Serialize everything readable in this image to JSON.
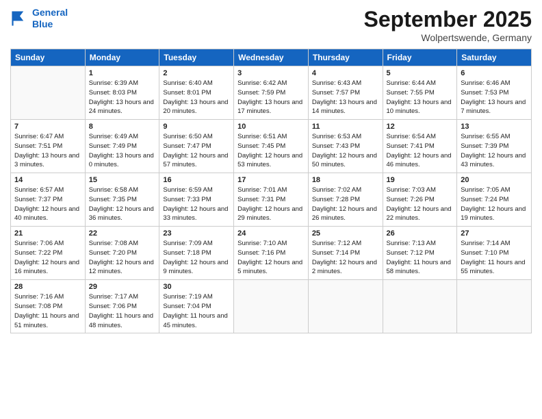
{
  "logo": {
    "line1": "General",
    "line2": "Blue"
  },
  "title": "September 2025",
  "location": "Wolpertswende, Germany",
  "weekdays": [
    "Sunday",
    "Monday",
    "Tuesday",
    "Wednesday",
    "Thursday",
    "Friday",
    "Saturday"
  ],
  "weeks": [
    [
      {
        "day": "",
        "sunrise": "",
        "sunset": "",
        "daylight": ""
      },
      {
        "day": "1",
        "sunrise": "Sunrise: 6:39 AM",
        "sunset": "Sunset: 8:03 PM",
        "daylight": "Daylight: 13 hours and 24 minutes."
      },
      {
        "day": "2",
        "sunrise": "Sunrise: 6:40 AM",
        "sunset": "Sunset: 8:01 PM",
        "daylight": "Daylight: 13 hours and 20 minutes."
      },
      {
        "day": "3",
        "sunrise": "Sunrise: 6:42 AM",
        "sunset": "Sunset: 7:59 PM",
        "daylight": "Daylight: 13 hours and 17 minutes."
      },
      {
        "day": "4",
        "sunrise": "Sunrise: 6:43 AM",
        "sunset": "Sunset: 7:57 PM",
        "daylight": "Daylight: 13 hours and 14 minutes."
      },
      {
        "day": "5",
        "sunrise": "Sunrise: 6:44 AM",
        "sunset": "Sunset: 7:55 PM",
        "daylight": "Daylight: 13 hours and 10 minutes."
      },
      {
        "day": "6",
        "sunrise": "Sunrise: 6:46 AM",
        "sunset": "Sunset: 7:53 PM",
        "daylight": "Daylight: 13 hours and 7 minutes."
      }
    ],
    [
      {
        "day": "7",
        "sunrise": "Sunrise: 6:47 AM",
        "sunset": "Sunset: 7:51 PM",
        "daylight": "Daylight: 13 hours and 3 minutes."
      },
      {
        "day": "8",
        "sunrise": "Sunrise: 6:49 AM",
        "sunset": "Sunset: 7:49 PM",
        "daylight": "Daylight: 13 hours and 0 minutes."
      },
      {
        "day": "9",
        "sunrise": "Sunrise: 6:50 AM",
        "sunset": "Sunset: 7:47 PM",
        "daylight": "Daylight: 12 hours and 57 minutes."
      },
      {
        "day": "10",
        "sunrise": "Sunrise: 6:51 AM",
        "sunset": "Sunset: 7:45 PM",
        "daylight": "Daylight: 12 hours and 53 minutes."
      },
      {
        "day": "11",
        "sunrise": "Sunrise: 6:53 AM",
        "sunset": "Sunset: 7:43 PM",
        "daylight": "Daylight: 12 hours and 50 minutes."
      },
      {
        "day": "12",
        "sunrise": "Sunrise: 6:54 AM",
        "sunset": "Sunset: 7:41 PM",
        "daylight": "Daylight: 12 hours and 46 minutes."
      },
      {
        "day": "13",
        "sunrise": "Sunrise: 6:55 AM",
        "sunset": "Sunset: 7:39 PM",
        "daylight": "Daylight: 12 hours and 43 minutes."
      }
    ],
    [
      {
        "day": "14",
        "sunrise": "Sunrise: 6:57 AM",
        "sunset": "Sunset: 7:37 PM",
        "daylight": "Daylight: 12 hours and 40 minutes."
      },
      {
        "day": "15",
        "sunrise": "Sunrise: 6:58 AM",
        "sunset": "Sunset: 7:35 PM",
        "daylight": "Daylight: 12 hours and 36 minutes."
      },
      {
        "day": "16",
        "sunrise": "Sunrise: 6:59 AM",
        "sunset": "Sunset: 7:33 PM",
        "daylight": "Daylight: 12 hours and 33 minutes."
      },
      {
        "day": "17",
        "sunrise": "Sunrise: 7:01 AM",
        "sunset": "Sunset: 7:31 PM",
        "daylight": "Daylight: 12 hours and 29 minutes."
      },
      {
        "day": "18",
        "sunrise": "Sunrise: 7:02 AM",
        "sunset": "Sunset: 7:28 PM",
        "daylight": "Daylight: 12 hours and 26 minutes."
      },
      {
        "day": "19",
        "sunrise": "Sunrise: 7:03 AM",
        "sunset": "Sunset: 7:26 PM",
        "daylight": "Daylight: 12 hours and 22 minutes."
      },
      {
        "day": "20",
        "sunrise": "Sunrise: 7:05 AM",
        "sunset": "Sunset: 7:24 PM",
        "daylight": "Daylight: 12 hours and 19 minutes."
      }
    ],
    [
      {
        "day": "21",
        "sunrise": "Sunrise: 7:06 AM",
        "sunset": "Sunset: 7:22 PM",
        "daylight": "Daylight: 12 hours and 16 minutes."
      },
      {
        "day": "22",
        "sunrise": "Sunrise: 7:08 AM",
        "sunset": "Sunset: 7:20 PM",
        "daylight": "Daylight: 12 hours and 12 minutes."
      },
      {
        "day": "23",
        "sunrise": "Sunrise: 7:09 AM",
        "sunset": "Sunset: 7:18 PM",
        "daylight": "Daylight: 12 hours and 9 minutes."
      },
      {
        "day": "24",
        "sunrise": "Sunrise: 7:10 AM",
        "sunset": "Sunset: 7:16 PM",
        "daylight": "Daylight: 12 hours and 5 minutes."
      },
      {
        "day": "25",
        "sunrise": "Sunrise: 7:12 AM",
        "sunset": "Sunset: 7:14 PM",
        "daylight": "Daylight: 12 hours and 2 minutes."
      },
      {
        "day": "26",
        "sunrise": "Sunrise: 7:13 AM",
        "sunset": "Sunset: 7:12 PM",
        "daylight": "Daylight: 11 hours and 58 minutes."
      },
      {
        "day": "27",
        "sunrise": "Sunrise: 7:14 AM",
        "sunset": "Sunset: 7:10 PM",
        "daylight": "Daylight: 11 hours and 55 minutes."
      }
    ],
    [
      {
        "day": "28",
        "sunrise": "Sunrise: 7:16 AM",
        "sunset": "Sunset: 7:08 PM",
        "daylight": "Daylight: 11 hours and 51 minutes."
      },
      {
        "day": "29",
        "sunrise": "Sunrise: 7:17 AM",
        "sunset": "Sunset: 7:06 PM",
        "daylight": "Daylight: 11 hours and 48 minutes."
      },
      {
        "day": "30",
        "sunrise": "Sunrise: 7:19 AM",
        "sunset": "Sunset: 7:04 PM",
        "daylight": "Daylight: 11 hours and 45 minutes."
      },
      {
        "day": "",
        "sunrise": "",
        "sunset": "",
        "daylight": ""
      },
      {
        "day": "",
        "sunrise": "",
        "sunset": "",
        "daylight": ""
      },
      {
        "day": "",
        "sunrise": "",
        "sunset": "",
        "daylight": ""
      },
      {
        "day": "",
        "sunrise": "",
        "sunset": "",
        "daylight": ""
      }
    ]
  ]
}
